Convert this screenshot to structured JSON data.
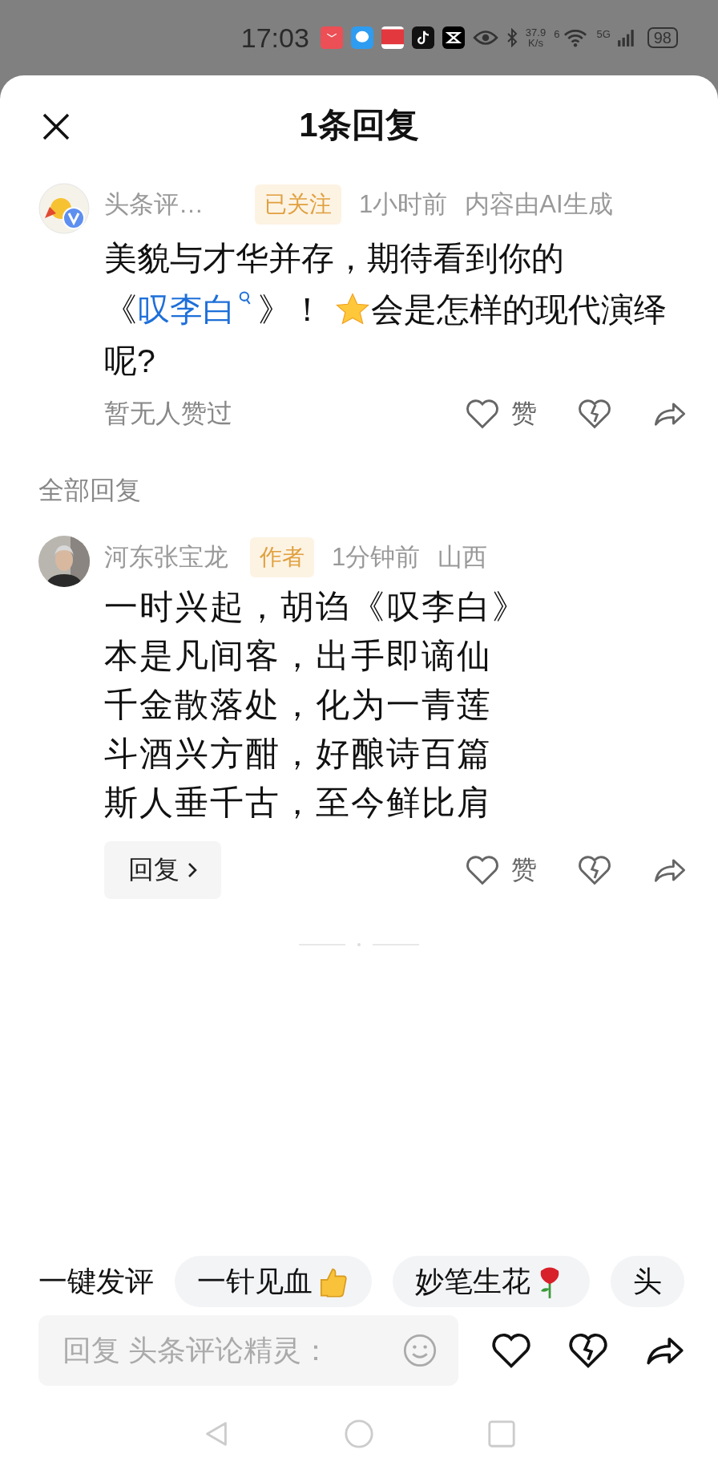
{
  "status_bar": {
    "time": "17:03",
    "net_speed": "37.9",
    "net_unit": "K/s",
    "wifi_badge": "6",
    "signal_type": "5G",
    "battery": "98"
  },
  "header": {
    "title": "1条回复"
  },
  "comment": {
    "author": "头条评…",
    "follow_badge": "已关注",
    "time": "1小时前",
    "note": "内容由AI生成",
    "text_start": "美貌与才华并存，期待看到你的《",
    "link": "叹李白",
    "text_after_link": "》！",
    "text_end": "会是怎样的现代演绎呢?",
    "likes_note": "暂无人赞过",
    "like_label": "赞"
  },
  "section_title": "全部回复",
  "replies": [
    {
      "author": "河东张宝龙",
      "badge": "作者",
      "time": "1分钟前",
      "location": "山西",
      "lines": [
        "一时兴起，胡诌《叹李白》",
        "本是凡间客，出手即谪仙",
        "千金散落处，化为一青莲",
        "斗酒兴方酣，好酿诗百篇",
        "斯人垂千古，至今鲜比肩"
      ],
      "reply_button": "回复",
      "like_label": "赞"
    }
  ],
  "quick_comments": {
    "label": "一键发评",
    "chips": [
      {
        "text": "一针见血",
        "kind": "thumbs"
      },
      {
        "text": "妙笔生花",
        "kind": "rose"
      },
      {
        "text": "头",
        "kind": "plain"
      }
    ]
  },
  "input": {
    "placeholder": "回复 头条评论精灵："
  }
}
